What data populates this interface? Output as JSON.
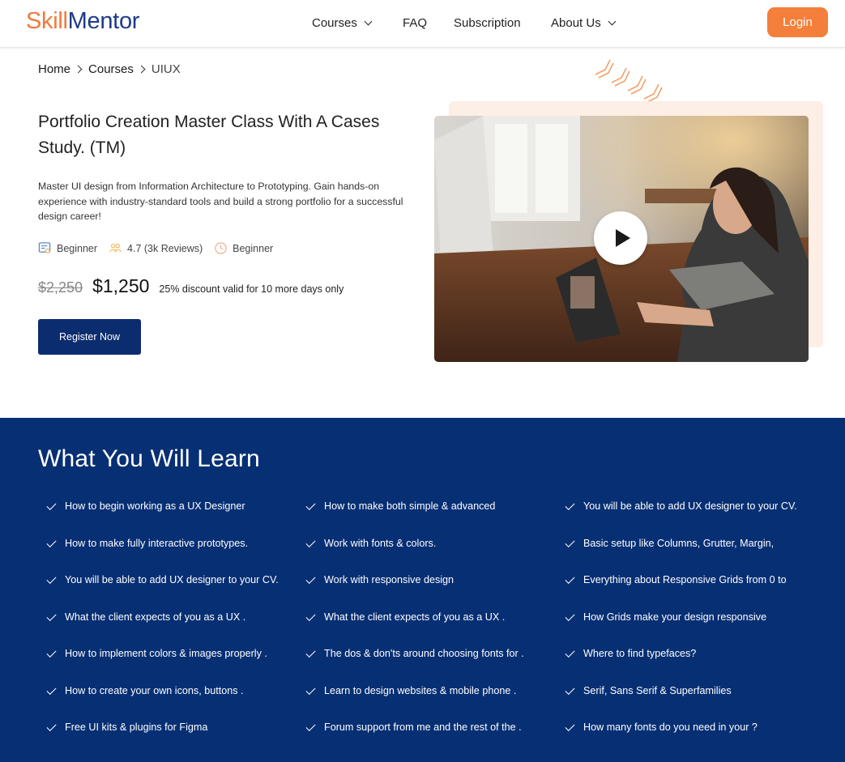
{
  "brand": {
    "part1": "Skill",
    "part2": "Mentor",
    "color_primary": "#f2793a",
    "color_secondary": "#1e3a8a"
  },
  "nav": {
    "courses": "Courses",
    "faq": "FAQ",
    "subscription": "Subscription",
    "about": "About Us",
    "login": "Login"
  },
  "breadcrumb": {
    "home": "Home",
    "courses": "Courses",
    "current": "UIUX"
  },
  "course": {
    "title": "Portfolio Creation Master Class With A Cases Study. (TM)",
    "description": "Master UI design from Information Architecture to Prototyping. Gain hands-on experience with industry-standard tools and build a strong portfolio for a successful design career!",
    "level": "Beginner",
    "rating": "4.7 (3k Reviews)",
    "duration": "Beginner",
    "price_old": "$2,250",
    "price_new": "$1,250",
    "discount_note": "25% discount valid for 10 more days only",
    "register_label": "Register Now"
  },
  "learn": {
    "title": "What You Will Learn",
    "col1": [
      "How to begin working as a UX Designer",
      "How to make fully interactive prototypes.",
      "You will be able to add UX designer to your CV.",
      "What the client expects of you as a UX .",
      "How to implement colors & images properly .",
      "How to create your own icons, buttons .",
      "Free UI kits & plugins for Figma"
    ],
    "col2": [
      "How to make both simple & advanced",
      "Work with fonts & colors.",
      "Work with responsive design",
      "What the client expects of you as a UX .",
      "The dos & don'ts around choosing fonts for .",
      "Learn to design websites & mobile phone .",
      "Forum support from me and the rest of the ."
    ],
    "col3": [
      "You will be able to add UX designer to your CV.",
      "Basic setup like Columns, Grutter, Margin,",
      "Everything about Responsive Grids from 0 to",
      "How Grids make your design responsive",
      "Where to find typefaces?",
      "Serif, Sans Serif & Superfamilies",
      "How many fonts do you need in your ?"
    ]
  },
  "colors": {
    "accent_orange": "#f47f3a",
    "navy": "#0b2c6e",
    "learn_bg": "#072f74",
    "peach": "#fdeee6"
  }
}
